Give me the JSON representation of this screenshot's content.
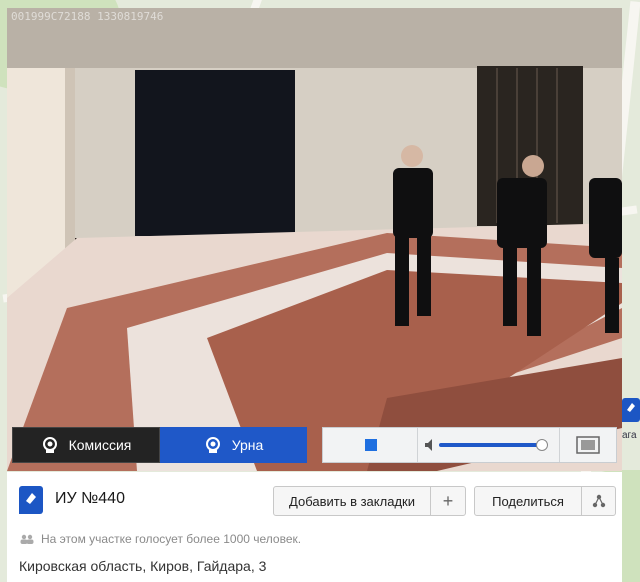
{
  "video": {
    "timestamp": "001999C72188 1330819746"
  },
  "controls": {
    "commission_label": "Комиссия",
    "urn_label": "Урна",
    "volume_level": 0.95
  },
  "station": {
    "title": "ИУ №440",
    "bookmark_label": "Добавить в закладки",
    "share_label": "Поделиться",
    "notice": "На этом участке голосует более 1000 человек.",
    "address": "Кировская область, Киров, Гайдара, 3"
  },
  "map": {
    "marker_label": "ага"
  },
  "colors": {
    "accent": "#1f58c8",
    "dark_button": "#232323"
  }
}
